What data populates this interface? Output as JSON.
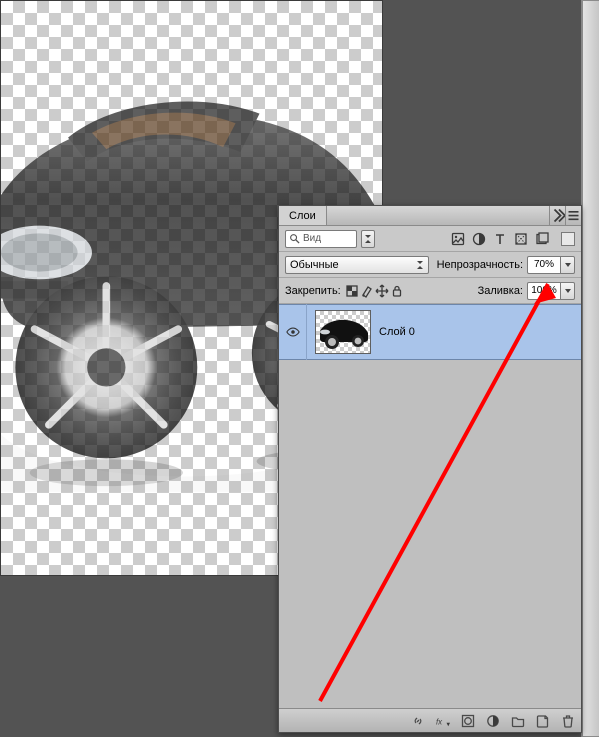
{
  "colors": {
    "annotation_arrow": "#ff0000",
    "selected_layer_bg": "#a9c4ea",
    "panel_bg": "#bdbdbd"
  },
  "panel": {
    "tab_title": "Слои",
    "search_label": "Вид",
    "blend_mode": "Обычные",
    "opacity_label": "Непрозрачность:",
    "opacity_value": "70%",
    "lock_label": "Закрепить:",
    "fill_label": "Заливка:",
    "fill_value": "100%",
    "filter_icons": [
      "image-filter",
      "adjust-filter",
      "text-filter",
      "shape-filter",
      "smart-filter"
    ],
    "lock_icons": [
      "lock-transparent",
      "lock-paint",
      "lock-move",
      "lock-all"
    ]
  },
  "layers": [
    {
      "name": "Слой 0",
      "visible": true,
      "selected": true
    }
  ],
  "footer_icons": [
    "link-icon",
    "fx-icon",
    "mask-icon",
    "adjustment-icon",
    "group-icon",
    "new-layer-icon",
    "trash-icon"
  ]
}
